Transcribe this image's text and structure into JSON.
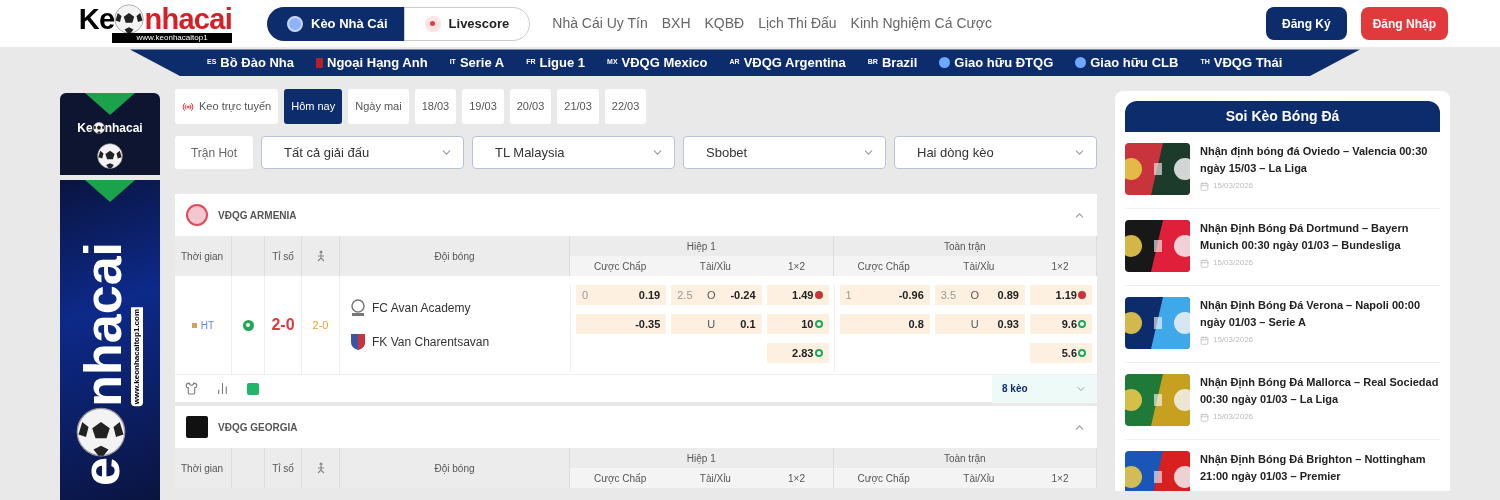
{
  "header": {
    "logo": {
      "start": "Ke",
      "end": "nhacai",
      "url": "www.keonhacaitop1"
    },
    "tabs": [
      {
        "label": "Kèo Nhà Cái",
        "kind": "ball",
        "selected": true
      },
      {
        "label": "Livescore",
        "kind": "live",
        "selected": false
      }
    ],
    "links": [
      "Nhà Cái Uy Tín",
      "BXH",
      "KQBĐ",
      "Lịch Thi Đấu",
      "Kinh Nghiệm Cá Cược"
    ],
    "register": "Đăng Ký",
    "login": "Đăng Nhập"
  },
  "leagues_bar": [
    {
      "kind": "code",
      "code": "ES",
      "label": "Bồ Đào Nha"
    },
    {
      "kind": "flag",
      "label": "Ngoại Hạng Anh"
    },
    {
      "kind": "code",
      "code": "IT",
      "label": "Serie A"
    },
    {
      "kind": "code",
      "code": "FR",
      "label": "Ligue 1"
    },
    {
      "kind": "code",
      "code": "MX",
      "label": "VĐQG Mexico"
    },
    {
      "kind": "code",
      "code": "AR",
      "label": "VĐQG Argentina"
    },
    {
      "kind": "code",
      "code": "BR",
      "label": "Brazil"
    },
    {
      "kind": "globe",
      "label": "Giao hữu ĐTQG"
    },
    {
      "kind": "globe",
      "label": "Giao hữu CLB"
    },
    {
      "kind": "code",
      "code": "TH",
      "label": "VĐQG Thái"
    }
  ],
  "banner": {
    "top": {
      "start": "Ke",
      "end": "nhacai"
    },
    "side": {
      "start": "e",
      "end": "nhacai",
      "url": "www.keonhacaitop1.com"
    }
  },
  "date_tabs": [
    {
      "kind": "live",
      "label": "Keo trực tuyến",
      "selected": false
    },
    {
      "kind": "date",
      "label": "Hôm nay",
      "selected": true
    },
    {
      "kind": "date",
      "label": "Ngày mai",
      "selected": false
    },
    {
      "kind": "date",
      "label": "18/03",
      "selected": false
    },
    {
      "kind": "date",
      "label": "19/03",
      "selected": false
    },
    {
      "kind": "date",
      "label": "20/03",
      "selected": false
    },
    {
      "kind": "date",
      "label": "21/03",
      "selected": false
    },
    {
      "kind": "date",
      "label": "22/03",
      "selected": false
    }
  ],
  "filters": {
    "hot": "Trận Hot",
    "selects": [
      "Tất cả giải đấu",
      "TL Malaysia",
      "Sbobet",
      "Hai dòng kèo"
    ]
  },
  "leagues": [
    {
      "name": "VĐQG ARMENIA",
      "expanded": true,
      "columns": {
        "time": "Thời gian",
        "score": "Tỉ số",
        "teams": "Đội bóng",
        "periods": [
          {
            "title": "Hiệp 1",
            "sub": [
              "Cược Chấp",
              "Tài/Xỉu",
              "1×2"
            ]
          },
          {
            "title": "Toàn trận",
            "sub": [
              "Cược Chấp",
              "Tài/Xỉu",
              "1×2"
            ]
          }
        ]
      },
      "matches": [
        {
          "status": "HT",
          "live": true,
          "score": "2-0",
          "score_ht": "2-0",
          "teams": [
            "FC Avan Academy",
            "FK Van Charentsavan"
          ],
          "periods": [
            {
              "handicap": [
                {
                  "line": "0",
                  "odds": "0.19"
                },
                {
                  "odds": "-0.35"
                }
              ],
              "total": [
                {
                  "line": "2.5",
                  "side": "O",
                  "odds": "-0.24"
                },
                {
                  "side": "U",
                  "odds": "0.1"
                }
              ],
              "x12": [
                {
                  "odds": "1.49",
                  "down": true
                },
                {
                  "odds": "10",
                  "down": false
                },
                {
                  "odds": "2.83",
                  "down": false
                }
              ]
            },
            {
              "handicap": [
                {
                  "line": "1",
                  "odds": "-0.96"
                },
                {
                  "odds": "0.8"
                }
              ],
              "total": [
                {
                  "line": "3.5",
                  "side": "O",
                  "odds": "0.89"
                },
                {
                  "side": "U",
                  "odds": "0.93"
                }
              ],
              "x12": [
                {
                  "odds": "1.19",
                  "down": true
                },
                {
                  "odds": "9.6",
                  "down": false
                },
                {
                  "odds": "5.6",
                  "down": false
                }
              ]
            }
          ],
          "more": "8 kèo"
        }
      ]
    },
    {
      "name": "VĐQG GEORGIA",
      "expanded": true,
      "columns": {
        "time": "Thời gian",
        "score": "Tỉ số",
        "teams": "Đội bóng",
        "periods": [
          {
            "title": "Hiệp 1",
            "sub": [
              "Cược Chấp",
              "Tài/Xỉu",
              "1×2"
            ]
          },
          {
            "title": "Toàn trận",
            "sub": [
              "Cược Chấp",
              "Tài/Xỉu",
              "1×2"
            ]
          }
        ]
      }
    }
  ],
  "sidebar": {
    "title": "Soi Kèo Bóng Đá",
    "articles": [
      {
        "title": "Nhận định bóng đá Oviedo – Valencia 00:30 ngày 15/03 – La Liga",
        "date": "15/03/2026"
      },
      {
        "title": "Nhận Định Bóng Đá Dortmund – Bayern Munich 00:30 ngày 01/03 – Bundesliga",
        "date": "15/03/2026"
      },
      {
        "title": "Nhận Định Bóng Đá Verona – Napoli 00:00 ngày 01/03 – Serie A",
        "date": "15/03/2026"
      },
      {
        "title": "Nhận Định Bóng Đá Mallorca – Real Sociedad 00:30 ngày 01/03 – La Liga",
        "date": "15/03/2026"
      },
      {
        "title": "Nhận Định Bóng Đá Brighton – Nottingham 21:00 ngày 01/03 – Premier"
      }
    ]
  }
}
